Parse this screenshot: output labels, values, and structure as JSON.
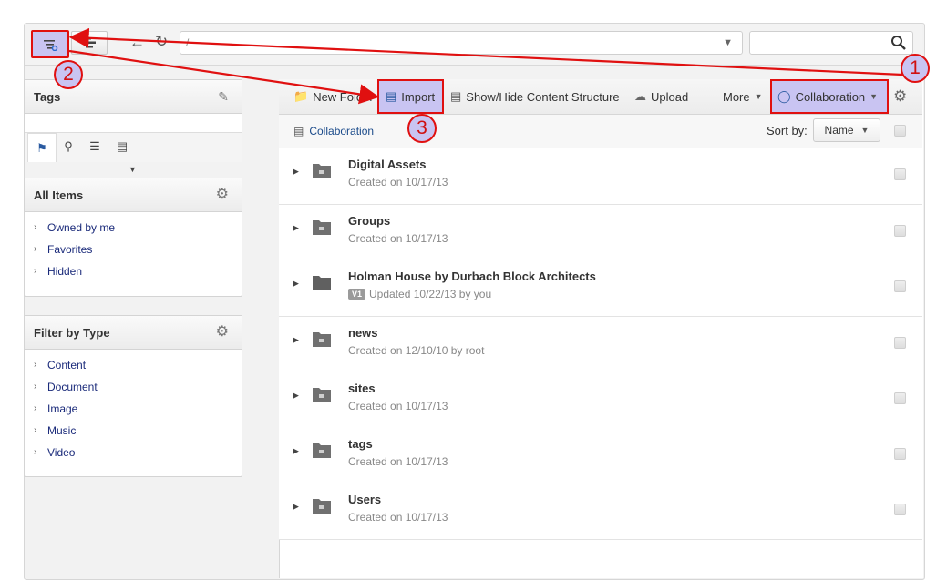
{
  "toolbar": {
    "address_value": "/",
    "search_value": ""
  },
  "sidebar": {
    "tags": {
      "title": "Tags"
    },
    "all_items": {
      "title": "All Items",
      "items": [
        "Owned by me",
        "Favorites",
        "Hidden"
      ]
    },
    "filter_by_type": {
      "title": "Filter by Type",
      "items": [
        "Content",
        "Document",
        "Image",
        "Music",
        "Video"
      ]
    }
  },
  "actions": {
    "new_folder": "New Folder",
    "import": "Import",
    "show_hide": "Show/Hide Content Structure",
    "upload": "Upload",
    "more": "More",
    "collaboration": "Collaboration"
  },
  "breadcrumb": {
    "current": "Collaboration"
  },
  "sort": {
    "label": "Sort by:",
    "value": "Name"
  },
  "rows": [
    {
      "name": "Digital Assets",
      "meta": "Created on 10/17/13"
    },
    {
      "name": "Groups",
      "meta": "Created on 10/17/13"
    },
    {
      "name": "Holman House by Durbach Block Architects",
      "badge": "V1",
      "meta": "Updated 10/22/13 by you"
    },
    {
      "name": "news",
      "meta": "Created on 12/10/10 by root"
    },
    {
      "name": "sites",
      "meta": "Created on 10/17/13"
    },
    {
      "name": "tags",
      "meta": "Created on 10/17/13"
    },
    {
      "name": "Users",
      "meta": "Created on 10/17/13"
    }
  ],
  "callouts": [
    "1",
    "2",
    "3"
  ],
  "colors": {
    "highlight": "#c9c4f2",
    "annotation": "#e01010",
    "link": "#1a2a7a"
  }
}
